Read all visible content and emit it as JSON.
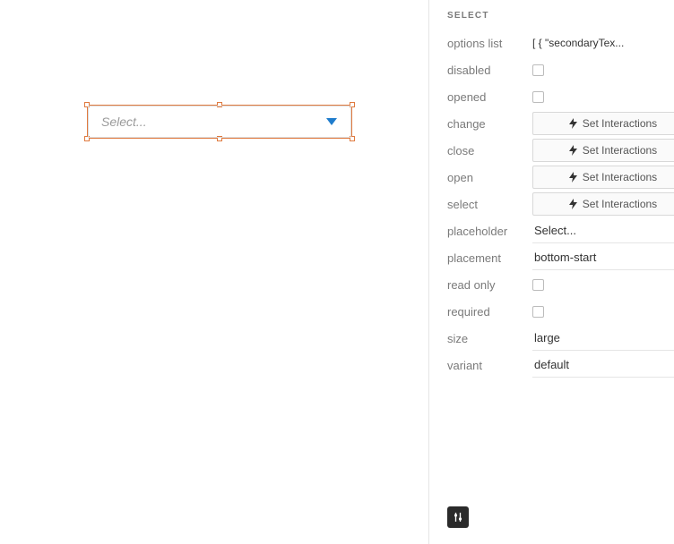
{
  "canvas": {
    "component_placeholder": "Select..."
  },
  "panel": {
    "title": "SELECT",
    "props": {
      "options_list": {
        "label": "options list",
        "preview": "[ { \"secondaryTex..."
      },
      "disabled": {
        "label": "disabled"
      },
      "opened": {
        "label": "opened"
      },
      "change": {
        "label": "change",
        "button": "Set Interactions"
      },
      "close": {
        "label": "close",
        "button": "Set Interactions"
      },
      "open": {
        "label": "open",
        "button": "Set Interactions"
      },
      "select": {
        "label": "select",
        "button": "Set Interactions"
      },
      "placeholder": {
        "label": "placeholder",
        "value": "Select..."
      },
      "placement": {
        "label": "placement",
        "value": "bottom-start"
      },
      "read_only": {
        "label": "read only"
      },
      "required": {
        "label": "required"
      },
      "size": {
        "label": "size",
        "value": "large"
      },
      "variant": {
        "label": "variant",
        "value": "default"
      }
    }
  }
}
